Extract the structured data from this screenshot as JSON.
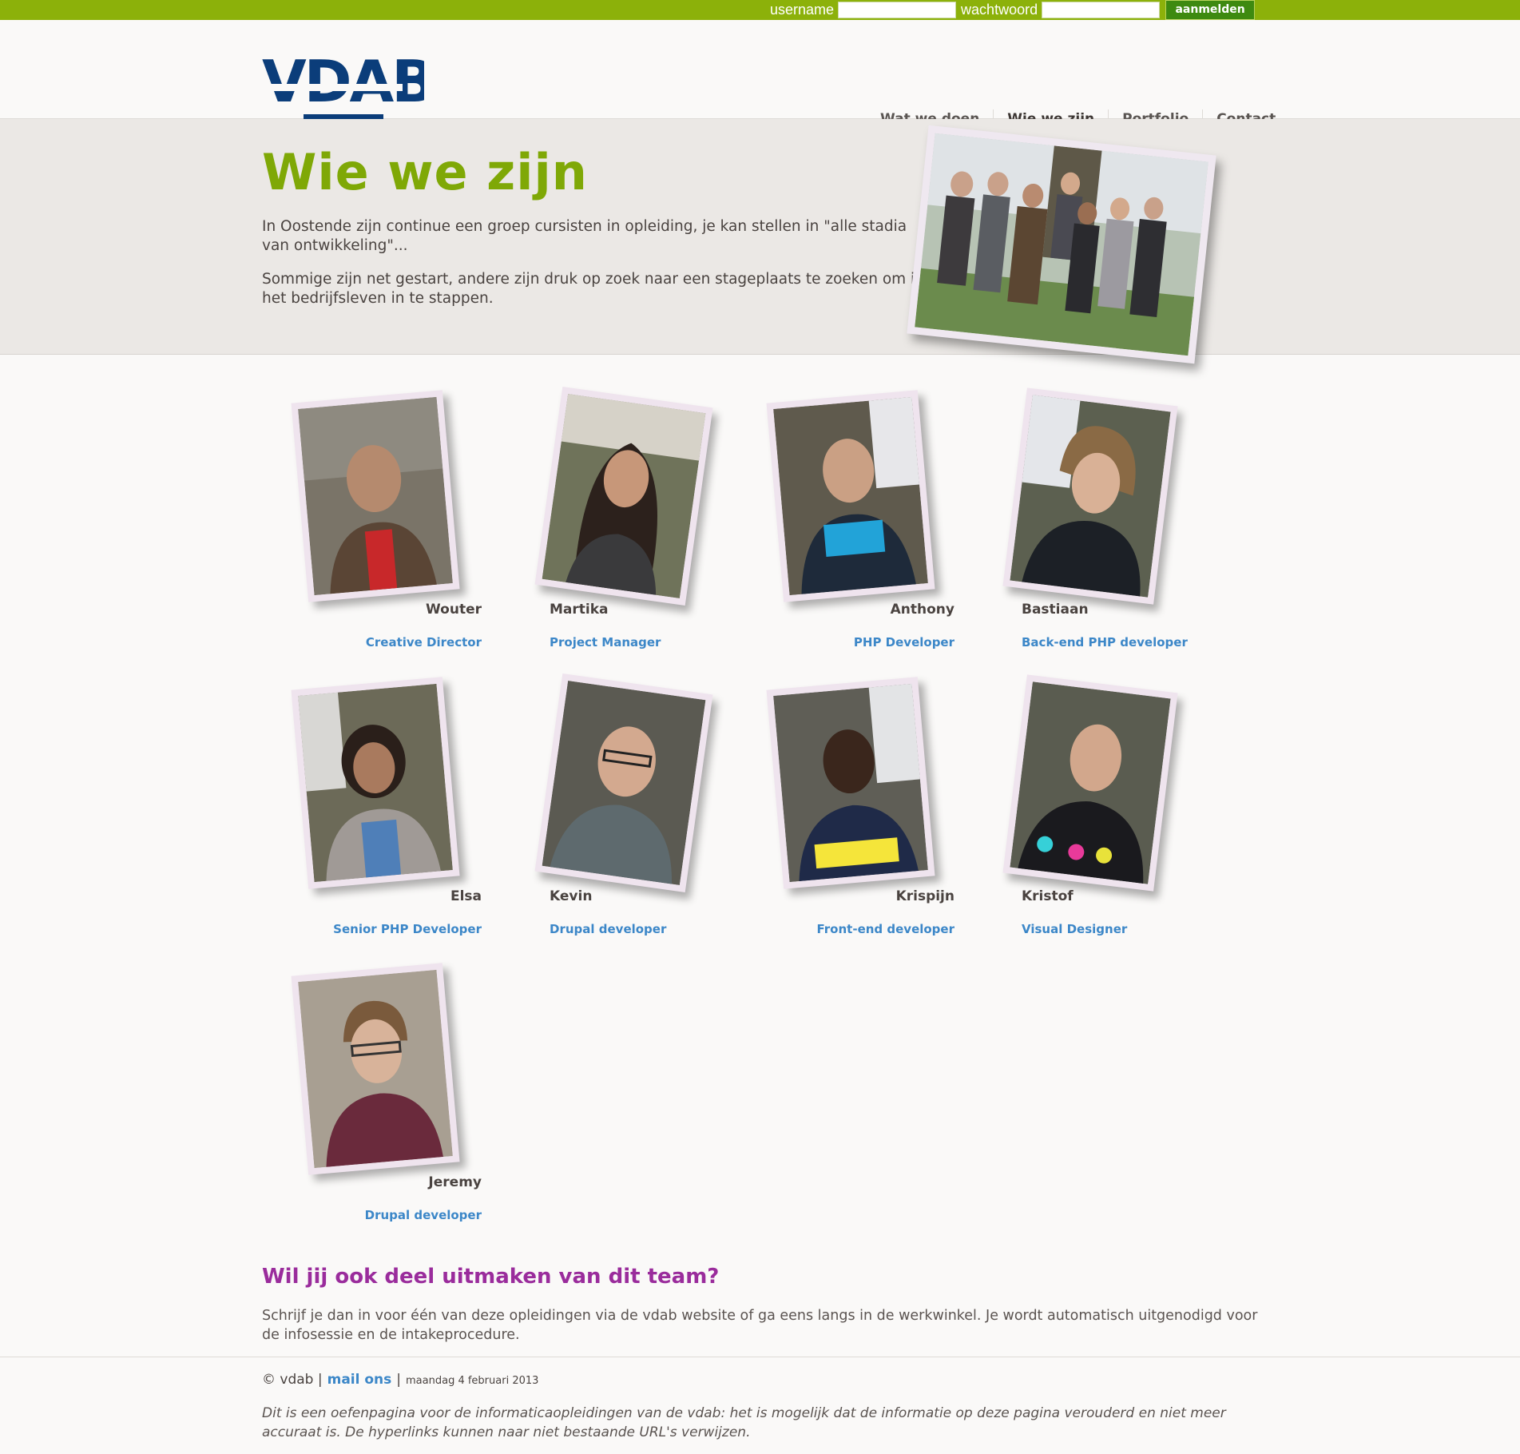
{
  "login": {
    "username_label": "username",
    "password_label": "wachtwoord",
    "submit_label": "aanmelden"
  },
  "brand": {
    "logo_text": "VDAB"
  },
  "nav": {
    "items": [
      {
        "label": "Wat we doen"
      },
      {
        "label": "Wie we zijn"
      },
      {
        "label": "Portfolio"
      },
      {
        "label": "Contact"
      }
    ]
  },
  "intro": {
    "title": "Wie we zijn",
    "p1": "In Oostende zijn continue een groep cursisten in opleiding, je kan stellen in \"alle stadia van ontwikkeling\"...",
    "p2": "Sommige zijn net gestart, andere zijn druk op zoek naar een stageplaats te zoeken om in het bedrijfsleven in te stappen."
  },
  "team": [
    {
      "name": "Wouter",
      "role": "Creative Director"
    },
    {
      "name": "Martika",
      "role": "Project Manager"
    },
    {
      "name": "Anthony",
      "role": "PHP Developer"
    },
    {
      "name": "Bastiaan",
      "role": "Back-end PHP developer"
    },
    {
      "name": "Elsa",
      "role": "Senior PHP Developer"
    },
    {
      "name": "Kevin",
      "role": "Drupal developer"
    },
    {
      "name": "Krispijn",
      "role": "Front-end developer"
    },
    {
      "name": "Kristof",
      "role": "Visual Designer"
    },
    {
      "name": "Jeremy",
      "role": "Drupal developer"
    }
  ],
  "join": {
    "title": "Wil jij ook deel uitmaken van dit team?",
    "text": "Schrijf je dan in voor één van deze opleidingen via de vdab website of ga eens langs in de werkwinkel. Je wordt automatisch uitgenodigd voor de infosessie en de intakeprocedure."
  },
  "footer": {
    "copyright": "© vdab |",
    "mail_link": "mail ons",
    "separator": "|",
    "date": "maandag 4 februari 2013",
    "disclaimer": "Dit is een oefenpagina voor de informaticaopleidingen van de vdab: het is mogelijk dat de informatie op deze pagina verouderd en niet meer accuraat is. De hyperlinks kunnen naar niet bestaande URL's verwijzen."
  },
  "colors": {
    "topbar": "#8cb10a",
    "title_green": "#7fa806",
    "logo_blue": "#0b3d7a",
    "role_blue": "#3c87c8",
    "join_purple": "#9a2c9c"
  }
}
